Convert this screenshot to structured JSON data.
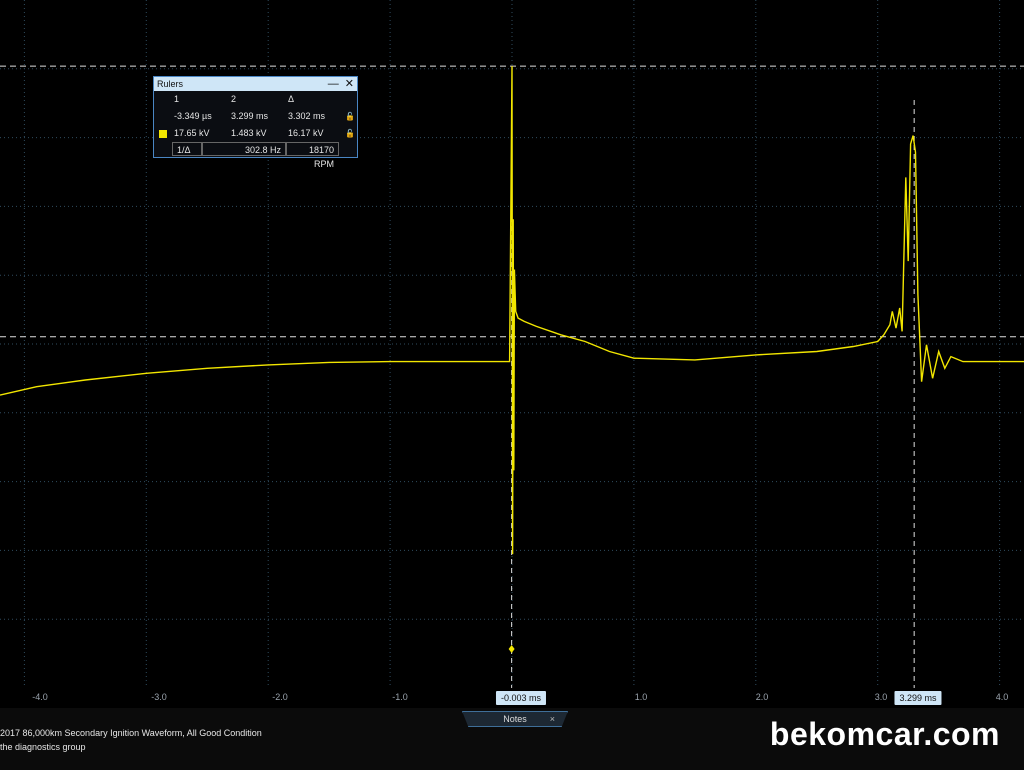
{
  "rulers_panel": {
    "title": "Rulers",
    "minimize_icon": "—",
    "close_icon": "✕",
    "headers": [
      "1",
      "2",
      "Δ"
    ],
    "time_row": {
      "r1": "-3.349 µs",
      "r2": "3.299 ms",
      "delta": "3.302 ms"
    },
    "voltage_row": {
      "r1": "17.65 kV",
      "r2": "1.483 kV",
      "delta": "16.17 kV"
    },
    "lock_icon_symbol": "🔓",
    "freq_row": {
      "label": "1/Δ",
      "hz": "302.8 Hz",
      "rpm": "18170 RPM"
    },
    "swatch_color": "#f2e600"
  },
  "time_axis": {
    "ticks": [
      "-4.0",
      "-3.0",
      "-2.0",
      "-1.0",
      "1.0",
      "2.0",
      "3.0",
      "4.0"
    ]
  },
  "ruler_flags": {
    "r1": "-0.003 ms",
    "r2": "3.299 ms"
  },
  "notes": {
    "tab_label": "Notes",
    "close_symbol": "×",
    "line1": "2017 86,000km Secondary Ignition Waveform, All Good Condition",
    "line2": "the diagnostics group"
  },
  "watermark": "bekomcar.com",
  "colors": {
    "trace": "#f2e600",
    "grid": "#2f4b5e",
    "ruler": "#e0e0e0",
    "background": "#000000"
  },
  "chart_data": {
    "type": "line",
    "xlabel": "",
    "ylabel": "",
    "x_unit": "ms",
    "y_unit": "kV",
    "xlim": [
      -4.2,
      4.2
    ],
    "ylim": [
      -19.5,
      21.6
    ],
    "series": [
      {
        "x": [
          -4.2,
          -3.9,
          -3.5,
          -3.0,
          -2.5,
          -2.0,
          -1.5,
          -1.0,
          -0.5,
          -0.02,
          0.0,
          0.005,
          0.01,
          0.015,
          0.02,
          0.03,
          0.05,
          0.1,
          0.2,
          0.4,
          0.6,
          0.8,
          1.0,
          1.5,
          2.0,
          2.5,
          2.8,
          3.0,
          3.05,
          3.1,
          3.12,
          3.15,
          3.18,
          3.2,
          3.23,
          3.25,
          3.27,
          3.29,
          3.31,
          3.33,
          3.36,
          3.4,
          3.45,
          3.5,
          3.55,
          3.6,
          3.7,
          3.8,
          4.0,
          4.2
        ],
        "y": [
          -2.0,
          -1.5,
          -1.1,
          -0.7,
          -0.4,
          -0.2,
          -0.05,
          0.0,
          0.0,
          0.0,
          17.65,
          -11.5,
          8.5,
          -6.5,
          5.5,
          3.0,
          2.6,
          2.4,
          2.1,
          1.6,
          1.2,
          0.6,
          0.2,
          0.1,
          0.4,
          0.6,
          0.9,
          1.2,
          1.6,
          2.2,
          3.0,
          2.0,
          3.2,
          1.8,
          11.0,
          6.0,
          13.0,
          13.5,
          12.5,
          4.0,
          -1.2,
          1.0,
          -1.0,
          0.6,
          -0.4,
          0.3,
          0.0,
          0.0,
          0.0,
          0.0
        ]
      }
    ],
    "rulers": {
      "time": [
        -0.003,
        3.299
      ],
      "voltage": [
        17.65,
        1.483
      ]
    }
  }
}
